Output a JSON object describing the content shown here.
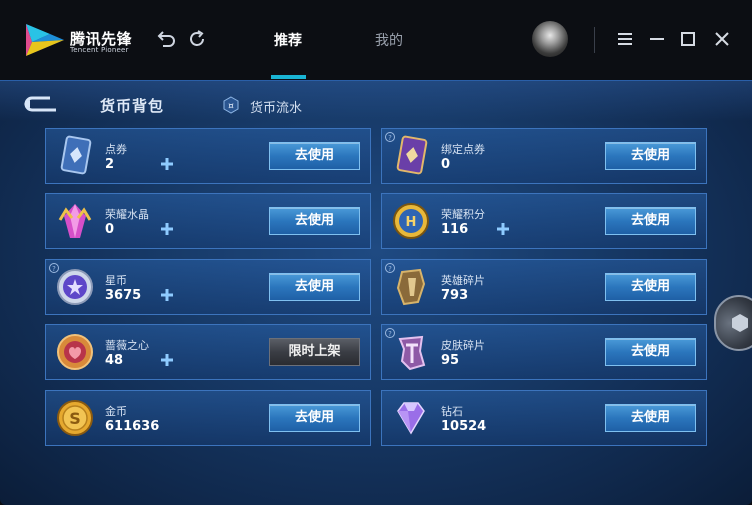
{
  "app": {
    "logo_cn": "腾讯先锋",
    "logo_en": "Tencent Pioneer"
  },
  "toolbar": {
    "back_icon": "undo-icon",
    "refresh_icon": "refresh-icon",
    "menu_icon": "hamburger-icon",
    "minimize_icon": "minimize-icon",
    "maximize_icon": "maximize-icon",
    "close_icon": "close-icon"
  },
  "tabs": [
    {
      "label": "推荐",
      "active": true
    },
    {
      "label": "我的",
      "active": false
    }
  ],
  "colors": {
    "accent": "#19b4d4",
    "panel": "#173a68",
    "card_border": "#3c74bd",
    "button": "#2b76bd"
  },
  "header": {
    "title": "货币背包",
    "flow_label": "货币流水"
  },
  "currencies": [
    {
      "name": "点券",
      "amount": "2",
      "icon": "coupon-card-icon",
      "action": "去使用",
      "has_plus": true,
      "help": false
    },
    {
      "name": "绑定点券",
      "amount": "0",
      "icon": "bound-coupon-card-icon",
      "action": "去使用",
      "has_plus": false,
      "help": true
    },
    {
      "name": "荣耀水晶",
      "amount": "0",
      "icon": "glory-crystal-icon",
      "action": "去使用",
      "has_plus": true,
      "help": false
    },
    {
      "name": "荣耀积分",
      "amount": "116",
      "icon": "glory-points-icon",
      "action": "去使用",
      "has_plus": true,
      "help": false
    },
    {
      "name": "星币",
      "amount": "3675",
      "icon": "star-coin-icon",
      "action": "去使用",
      "has_plus": true,
      "help": true
    },
    {
      "name": "英雄碎片",
      "amount": "793",
      "icon": "hero-fragment-icon",
      "action": "去使用",
      "has_plus": false,
      "help": true
    },
    {
      "name": "蔷薇之心",
      "amount": "48",
      "icon": "rose-heart-icon",
      "action": "限时上架",
      "has_plus": true,
      "help": false
    },
    {
      "name": "皮肤碎片",
      "amount": "95",
      "icon": "skin-fragment-icon",
      "action": "去使用",
      "has_plus": false,
      "help": true
    },
    {
      "name": "金币",
      "amount": "611636",
      "icon": "gold-coin-icon",
      "action": "去使用",
      "has_plus": false,
      "help": false
    },
    {
      "name": "钻石",
      "amount": "10524",
      "icon": "diamond-icon",
      "action": "去使用",
      "has_plus": false,
      "help": false
    }
  ]
}
